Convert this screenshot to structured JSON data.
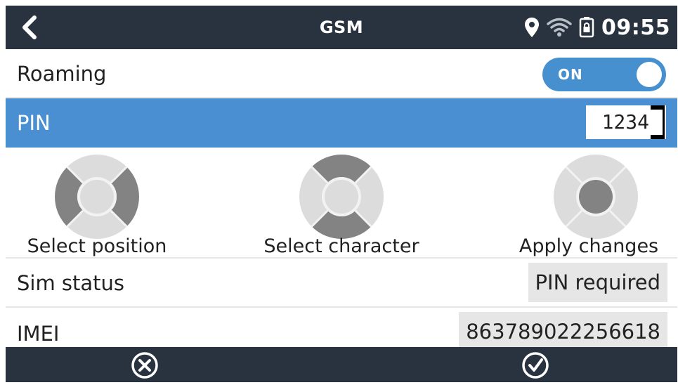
{
  "header": {
    "title": "GSM",
    "time": "09:55",
    "icons": [
      "back-chevron-icon",
      "location-pin-icon",
      "wifi-icon",
      "battery-lock-icon"
    ]
  },
  "roaming": {
    "label": "Roaming",
    "toggle_text": "ON",
    "toggle_state": "on",
    "accent": "#4790d0"
  },
  "pin": {
    "label": "PIN",
    "value": "1234",
    "highlight": "#4a8fd2"
  },
  "help": {
    "select_position": "Select position",
    "select_character": "Select character",
    "apply_changes": "Apply changes"
  },
  "sim_status": {
    "label": "Sim status",
    "value": "PIN required"
  },
  "imei": {
    "label": "IMEI",
    "value": "863789022256618"
  },
  "footer": {
    "icons": [
      "cancel-circle-icon",
      "confirm-check-icon"
    ]
  },
  "colors": {
    "header_bg": "#28333f",
    "row_divider": "#e6e6e6",
    "value_box_bg": "#e6e6e6"
  }
}
